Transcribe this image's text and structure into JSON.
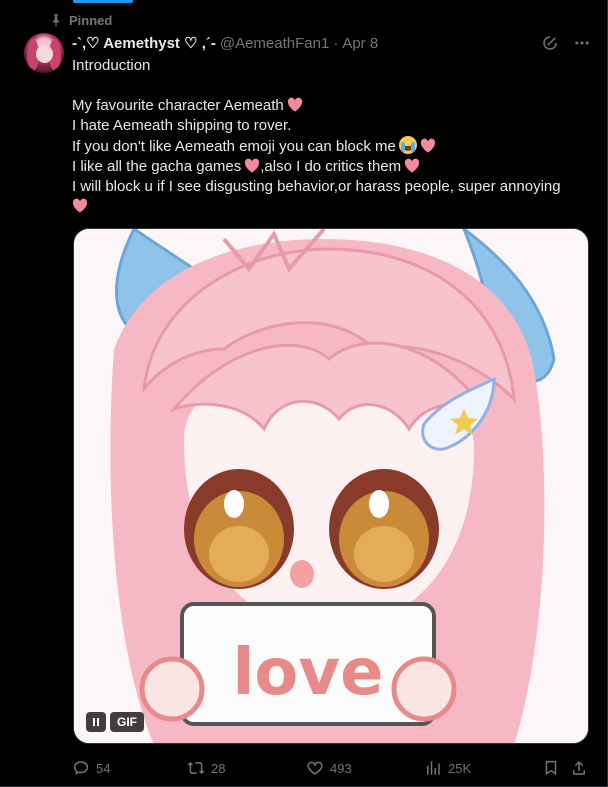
{
  "pinned": {
    "label": "Pinned",
    "icon": "pin-icon"
  },
  "author": {
    "display_name": "-`,♡ Aemethyst ♡ ,´-",
    "handle": "@AemeathFan1",
    "separator": "·",
    "date": "Apr 8"
  },
  "post": {
    "lines": [
      "Introduction",
      "",
      "My favourite character Aemeath",
      "I hate Aemeath shipping to rover.",
      "If you don't like Aemeath emoji you can block me",
      "I like all the gacha games",
      ",also I do critics them",
      "I will block u if I see disgusting behavior,or harass people, super annoying"
    ]
  },
  "media": {
    "badge": "GIF",
    "sign_text": "love"
  },
  "stats": {
    "replies": "54",
    "reposts": "28",
    "likes": "493",
    "views": "25K"
  },
  "colors": {
    "accent": "#1d9bf0",
    "muted": "#71767b",
    "text": "#e7e9ea",
    "heart": "#f4899d",
    "background": "#000000"
  }
}
